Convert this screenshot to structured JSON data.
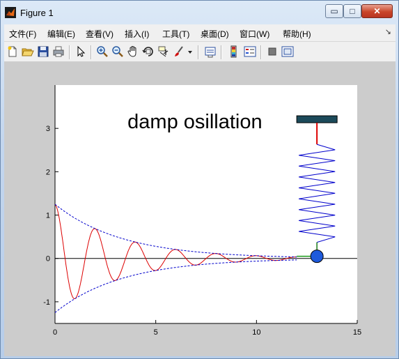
{
  "window": {
    "title": "Figure 1",
    "controls": {
      "minimize": "▭",
      "maximize": "□",
      "close": "✕"
    }
  },
  "menu": {
    "items": [
      "文件(F)",
      "编辑(E)",
      "查看(V)",
      "插入(I)",
      "工具(T)",
      "桌面(D)",
      "窗口(W)",
      "帮助(H)"
    ],
    "overflow": "↘"
  },
  "toolbar": {
    "icons": [
      "new-figure-icon",
      "open-file-icon",
      "save-icon",
      "print-icon",
      "edit-plot-arrow-icon",
      "zoom-in-icon",
      "zoom-out-icon",
      "pan-hand-icon",
      "rotate-3d-icon",
      "data-cursor-icon",
      "brush-icon",
      "brush-dropdown-icon",
      "link-plot-icon",
      "colorbar-icon",
      "legend-icon",
      "hide-plot-tools-icon",
      "show-plot-tools-icon"
    ]
  },
  "colors": {
    "signal": "#dd0000",
    "envelope": "#0000cc",
    "mass": "#1e5adc",
    "anchor": "#1c4a5a",
    "axis_bg": "#ffffff",
    "figure_bg": "#cccccc"
  },
  "chart_data": {
    "type": "line",
    "title": "",
    "annotation": "damp osillation",
    "xlim": [
      0,
      15
    ],
    "ylim": [
      -1.5,
      4
    ],
    "xticks": [
      0,
      5,
      10,
      15
    ],
    "yticks": [
      -1,
      0,
      1,
      2,
      3
    ],
    "series": [
      {
        "kind": "damped-oscillation",
        "amplitude": 1.25,
        "decay": 0.3,
        "period": 2.0,
        "x_start": 0,
        "x_end": 12
      },
      {
        "kind": "upper-envelope",
        "amplitude": 1.25,
        "decay": 0.3,
        "x_start": 0,
        "x_end": 12
      },
      {
        "kind": "lower-envelope",
        "amplitude": -1.25,
        "decay": 0.3,
        "x_start": 0,
        "x_end": 12
      }
    ],
    "spring": {
      "x": 13,
      "top": 3.05,
      "bottom": 0.05,
      "coils": 9
    },
    "mass_position": [
      13,
      0.05
    ]
  }
}
